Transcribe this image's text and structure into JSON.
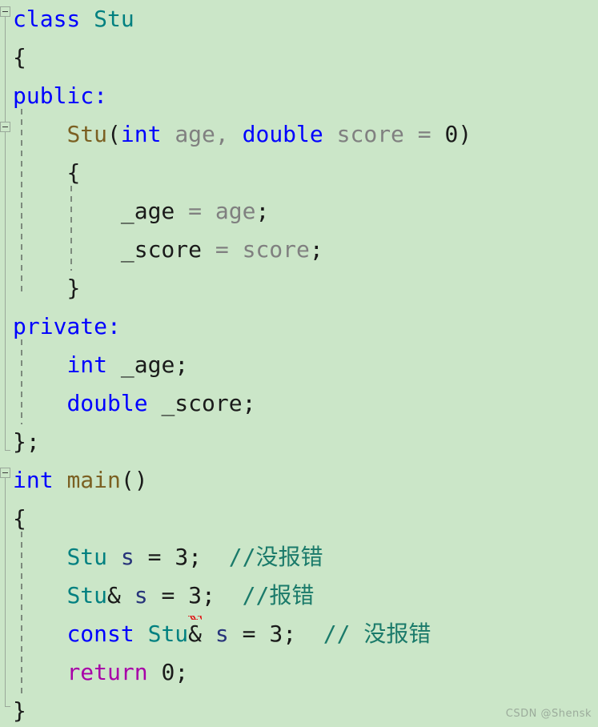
{
  "editor": {
    "background_color": "#cbe6c8",
    "language": "C++",
    "font_size_px": 28,
    "line_height_px": 48
  },
  "colors": {
    "keyword": "#0000ff",
    "type_name": "#008080",
    "function_name": "#7b6022",
    "return_keyword": "#a800a8",
    "comment": "#1a7a6a",
    "parameter": "#808080",
    "member": "#1a1a1a",
    "local_variable": "#27347a",
    "error_squiggle": "#e01b1b",
    "gutter_line": "#9aa89a",
    "indent_guide": "#7d8a7d"
  },
  "code": {
    "lines": [
      {
        "n": 1,
        "indent": 0,
        "tokens": [
          {
            "t": "class",
            "c": "kw"
          },
          {
            "t": " ",
            "c": "punc"
          },
          {
            "t": "Stu",
            "c": "type"
          }
        ]
      },
      {
        "n": 2,
        "indent": 0,
        "tokens": [
          {
            "t": "{",
            "c": "punc"
          }
        ]
      },
      {
        "n": 3,
        "indent": 0,
        "tokens": [
          {
            "t": "public:",
            "c": "kw"
          }
        ]
      },
      {
        "n": 4,
        "indent": 1,
        "tokens": [
          {
            "t": "Stu",
            "c": "fn"
          },
          {
            "t": "(",
            "c": "punc"
          },
          {
            "t": "int",
            "c": "kw"
          },
          {
            "t": " ",
            "c": "punc"
          },
          {
            "t": "age",
            "c": "par"
          },
          {
            "t": ", ",
            "c": "par"
          },
          {
            "t": "double",
            "c": "kw"
          },
          {
            "t": " ",
            "c": "punc"
          },
          {
            "t": "score",
            "c": "par"
          },
          {
            "t": " = ",
            "c": "par"
          },
          {
            "t": "0",
            "c": "num"
          },
          {
            "t": ")",
            "c": "punc"
          }
        ]
      },
      {
        "n": 5,
        "indent": 1,
        "tokens": [
          {
            "t": "{",
            "c": "punc"
          }
        ]
      },
      {
        "n": 6,
        "indent": 2,
        "tokens": [
          {
            "t": "_age",
            "c": "mem"
          },
          {
            "t": " = ",
            "c": "par"
          },
          {
            "t": "age",
            "c": "par"
          },
          {
            "t": ";",
            "c": "punc"
          }
        ]
      },
      {
        "n": 7,
        "indent": 2,
        "tokens": [
          {
            "t": "_score",
            "c": "mem"
          },
          {
            "t": " = ",
            "c": "par"
          },
          {
            "t": "score",
            "c": "par"
          },
          {
            "t": ";",
            "c": "punc"
          }
        ]
      },
      {
        "n": 8,
        "indent": 1,
        "tokens": [
          {
            "t": "}",
            "c": "punc"
          }
        ]
      },
      {
        "n": 9,
        "indent": 0,
        "tokens": [
          {
            "t": "private:",
            "c": "kw"
          }
        ]
      },
      {
        "n": 10,
        "indent": 1,
        "tokens": [
          {
            "t": "int",
            "c": "kw"
          },
          {
            "t": " ",
            "c": "punc"
          },
          {
            "t": "_age",
            "c": "mem"
          },
          {
            "t": ";",
            "c": "punc"
          }
        ]
      },
      {
        "n": 11,
        "indent": 1,
        "tokens": [
          {
            "t": "double",
            "c": "kw"
          },
          {
            "t": " ",
            "c": "punc"
          },
          {
            "t": "_score",
            "c": "mem"
          },
          {
            "t": ";",
            "c": "punc"
          }
        ]
      },
      {
        "n": 12,
        "indent": 0,
        "tokens": [
          {
            "t": "};",
            "c": "punc"
          }
        ]
      },
      {
        "n": 13,
        "indent": 0,
        "tokens": [
          {
            "t": "int",
            "c": "kw"
          },
          {
            "t": " ",
            "c": "punc"
          },
          {
            "t": "main",
            "c": "fn"
          },
          {
            "t": "()",
            "c": "punc"
          }
        ]
      },
      {
        "n": 14,
        "indent": 0,
        "tokens": [
          {
            "t": "{",
            "c": "punc"
          }
        ]
      },
      {
        "n": 15,
        "indent": 1,
        "tokens": [
          {
            "t": "Stu",
            "c": "type"
          },
          {
            "t": " ",
            "c": "punc"
          },
          {
            "t": "s",
            "c": "var"
          },
          {
            "t": " = ",
            "c": "punc"
          },
          {
            "t": "3",
            "c": "num"
          },
          {
            "t": ";",
            "c": "punc"
          },
          {
            "t": "  ",
            "c": "punc"
          },
          {
            "t": "//没报错",
            "c": "cmt"
          }
        ]
      },
      {
        "n": 16,
        "indent": 1,
        "tokens": [
          {
            "t": "Stu",
            "c": "type"
          },
          {
            "t": "&",
            "c": "punc"
          },
          {
            "t": " ",
            "c": "punc"
          },
          {
            "t": "s",
            "c": "var"
          },
          {
            "t": " = ",
            "c": "punc"
          },
          {
            "t": "3",
            "c": "num",
            "error": true
          },
          {
            "t": ";",
            "c": "punc"
          },
          {
            "t": "  ",
            "c": "punc"
          },
          {
            "t": "//报错",
            "c": "cmt"
          }
        ]
      },
      {
        "n": 17,
        "indent": 1,
        "tokens": [
          {
            "t": "const",
            "c": "kw"
          },
          {
            "t": " ",
            "c": "punc"
          },
          {
            "t": "Stu",
            "c": "type"
          },
          {
            "t": "&",
            "c": "punc"
          },
          {
            "t": " ",
            "c": "punc"
          },
          {
            "t": "s",
            "c": "var"
          },
          {
            "t": " = ",
            "c": "punc"
          },
          {
            "t": "3",
            "c": "num"
          },
          {
            "t": ";",
            "c": "punc"
          },
          {
            "t": "  ",
            "c": "punc"
          },
          {
            "t": "// 没报错",
            "c": "cmt"
          }
        ]
      },
      {
        "n": 18,
        "indent": 1,
        "tokens": [
          {
            "t": "return",
            "c": "ret"
          },
          {
            "t": " ",
            "c": "punc"
          },
          {
            "t": "0",
            "c": "num"
          },
          {
            "t": ";",
            "c": "punc"
          }
        ]
      },
      {
        "n": 19,
        "indent": 0,
        "tokens": [
          {
            "t": "}",
            "c": "punc"
          }
        ]
      }
    ]
  },
  "gutter": {
    "fold_markers": [
      {
        "name": "fold-class-stu",
        "line": 1,
        "expanded": true
      },
      {
        "name": "fold-constructor",
        "line": 4,
        "expanded": true
      },
      {
        "name": "fold-main",
        "line": 13,
        "expanded": true
      }
    ]
  },
  "watermark": {
    "text": "CSDN @Shensk"
  }
}
